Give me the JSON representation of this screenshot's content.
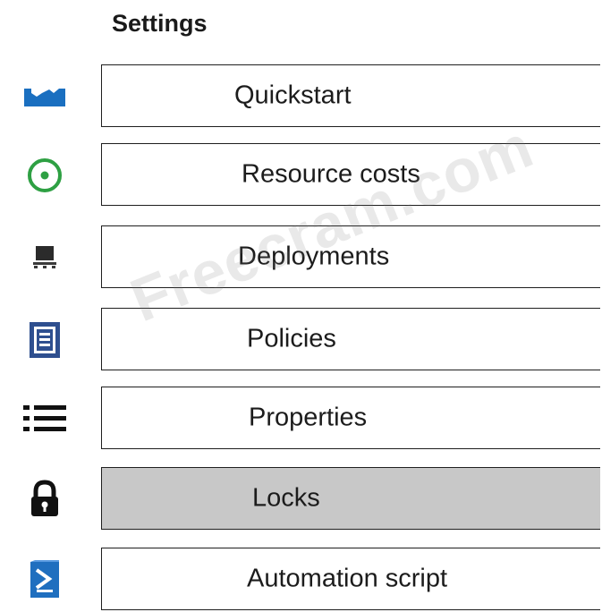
{
  "settings": {
    "heading": "Settings",
    "items": [
      {
        "label": "Quickstart",
        "icon": "quickstart-icon"
      },
      {
        "label": "Resource costs",
        "icon": "resource-costs-icon"
      },
      {
        "label": "Deployments",
        "icon": "deployments-icon"
      },
      {
        "label": "Policies",
        "icon": "policies-icon"
      },
      {
        "label": "Properties",
        "icon": "properties-icon"
      },
      {
        "label": "Locks",
        "icon": "lock-icon",
        "selected": true
      },
      {
        "label": "Automation script",
        "icon": "automation-script-icon"
      }
    ]
  },
  "watermark": "Freecram.com",
  "colors": {
    "quickstart_icon": "#1a6fc0",
    "resource_costs_icon": "#2ea043",
    "policies_icon": "#2e4f8f",
    "automation_icon": "#1f6fbf",
    "selected_row": "#c8c8c8",
    "border": "#1f1f1f"
  }
}
